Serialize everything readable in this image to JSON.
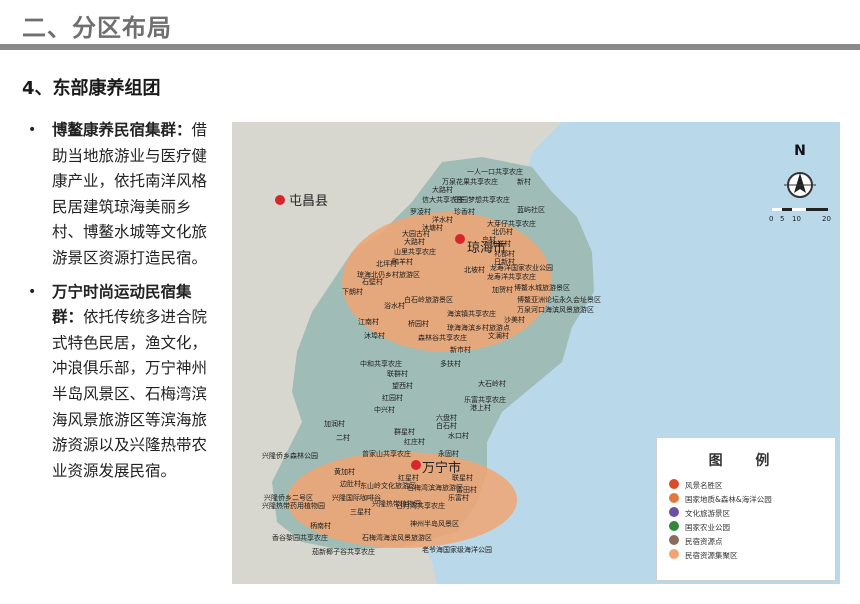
{
  "header": {
    "title": "二、分区布局"
  },
  "section": {
    "heading": "4、东部康养组团"
  },
  "bullets": [
    {
      "marker": "•",
      "title": "博鳌康养民宿集群：",
      "body": "借助当地旅游业与医疗健康产业，依托南洋风格民居建筑琼海美丽乡村、博鳌水城等文化旅游景区资源打造民宿。"
    },
    {
      "marker": "•",
      "title": "万宁时尚运动民宿集群：",
      "body": "依托传统多进合院式特色民居，渔文化，冲浪俱乐部，万宁神州半岛风景区、石梅湾滨海风景旅游区等滨海旅游资源以及兴隆热带农业资源发展民宿。"
    }
  ],
  "map": {
    "cities": {
      "tunchang": "屯昌县",
      "qionghai": "琼海市",
      "wanning": "万宁市"
    },
    "north_label": "N",
    "scale_labels": [
      "0",
      "5",
      "10",
      "20"
    ],
    "labels": {
      "l01": "一人一口共享农庄",
      "l02": "万泉花果共享农庄",
      "l03": "大路村",
      "l04": "新村",
      "l05": "信大共享农庄",
      "l06": "田园梦想共享农庄",
      "l07": "罗凌村",
      "l08": "珍香村",
      "l09": "蓝屿社区",
      "l10": "洋水村",
      "l11": "沐塘村",
      "l12": "大园古村",
      "l13": "大路村",
      "l14": "北仍村",
      "l15": "大芽仔共享农庄",
      "l16": "鸟村",
      "l17": "山里共享农庄",
      "l18": "鸭羊村",
      "l19": "北坡村",
      "l20": "加祥村",
      "l21": "礼都村",
      "l22": "日新村",
      "l23": "龙寿洋国家农业公园",
      "l24": "龙寿洋共享农庄",
      "l25": "琼海北仍乡村旅游区",
      "l26": "北坪村",
      "l27": "下朗村",
      "l28": "加贺村",
      "l29": "石壁村",
      "l30": "白石岭旅游景区",
      "l31": "博鳌水城旅游景区",
      "l32": "博鳌亚洲论坛永久会址景区",
      "l33": "万泉河口海滨风景旅游区",
      "l34": "沙美村",
      "l35": "浴水村",
      "l36": "海滨镇共享农庄",
      "l37": "江南村",
      "l38": "桥园村",
      "l39": "琼海海滨乡村旅游点",
      "l40": "沐埠村",
      "l41": "森林谷共享农庄",
      "l42": "新市村",
      "l43": "文澜村",
      "l44": "中和共享农庄",
      "l45": "多扶村",
      "l46": "联群村",
      "l47": "望西村",
      "l48": "大石岭村",
      "l49": "红园村",
      "l50": "乐富共享农庄",
      "l51": "中兴村",
      "l52": "港上村",
      "l53": "加润村",
      "l54": "六盘村",
      "l55": "白石村",
      "l56": "二村",
      "l57": "群星村",
      "l58": "红庄村",
      "l59": "水口村",
      "l60": "兴隆侨乡森林公园",
      "l61": "曾家山共享农庄",
      "l62": "永固村",
      "l63": "黄加村",
      "l64": "联星村",
      "l65": "红星村",
      "l66": "边肚村",
      "l67": "东山岭文化旅游区",
      "l68": "石梅湾滨海旅游区",
      "l69": "兴隆国际咖啡谷",
      "l70": "兴隆热带植物园",
      "l71": "兴隆侨乡二号区",
      "l72": "兴隆热带药用植物园",
      "l73": "神州半岛风景区",
      "l74": "三星村",
      "l75": "柄南村",
      "l76": "香谷黎园共享农庄",
      "l77": "石梅湾海滨风景旅游区",
      "l78": "日月湾共享农庄",
      "l79": "老爷海国家级海洋公园",
      "l80": "茄新椰子谷共享农庄",
      "l81": "富田村",
      "l82": "乐富村"
    }
  },
  "legend": {
    "title": "图 例",
    "items": [
      {
        "label": "风景名胜区",
        "color": "#d94b2b"
      },
      {
        "label": "国家地质&森林&海洋公园",
        "color": "#e07a3c"
      },
      {
        "label": "文化旅游景区",
        "color": "#6a4fa3"
      },
      {
        "label": "国家农业公园",
        "color": "#2f8a3a"
      },
      {
        "label": "民宿资源点",
        "color": "#8b6c5c"
      },
      {
        "label": "民宿资源集聚区",
        "color": "#f0a572"
      }
    ]
  }
}
